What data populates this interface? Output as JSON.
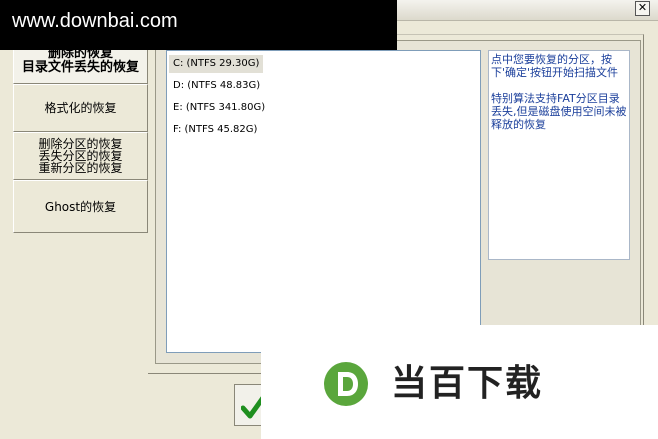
{
  "window": {
    "close_glyph": "✕"
  },
  "watermark": {
    "text": "www.downbai.com"
  },
  "tabs": [
    {
      "lines": [
        "删除的恢复",
        "目录文件丢失的恢复"
      ],
      "active": true
    },
    {
      "lines": [
        "格式化的恢复"
      ],
      "active": false
    },
    {
      "lines": [
        "删除分区的恢复",
        "丢失分区的恢复",
        "重新分区的恢复"
      ],
      "active": false
    },
    {
      "lines": [
        "Ghost的恢复"
      ],
      "active": false
    }
  ],
  "drives": [
    {
      "label": "C:  (NTFS 29.30G)",
      "selected": true
    },
    {
      "label": "D:  (NTFS 48.83G)",
      "selected": false
    },
    {
      "label": "E:  (NTFS 341.80G)",
      "selected": false
    },
    {
      "label": "F:  (NTFS 45.82G)",
      "selected": false
    }
  ],
  "info": {
    "line1": "点中您要恢复的分区，按下'确定'按钮开始扫描文件",
    "line2": "特别算法支持FAT分区目录丢失,但是磁盘使用空间未被释放的恢复"
  },
  "buttons": {
    "ok_icon": "check-icon"
  },
  "logo": {
    "text": "当百下载",
    "accent_color": "#5aa63c"
  }
}
